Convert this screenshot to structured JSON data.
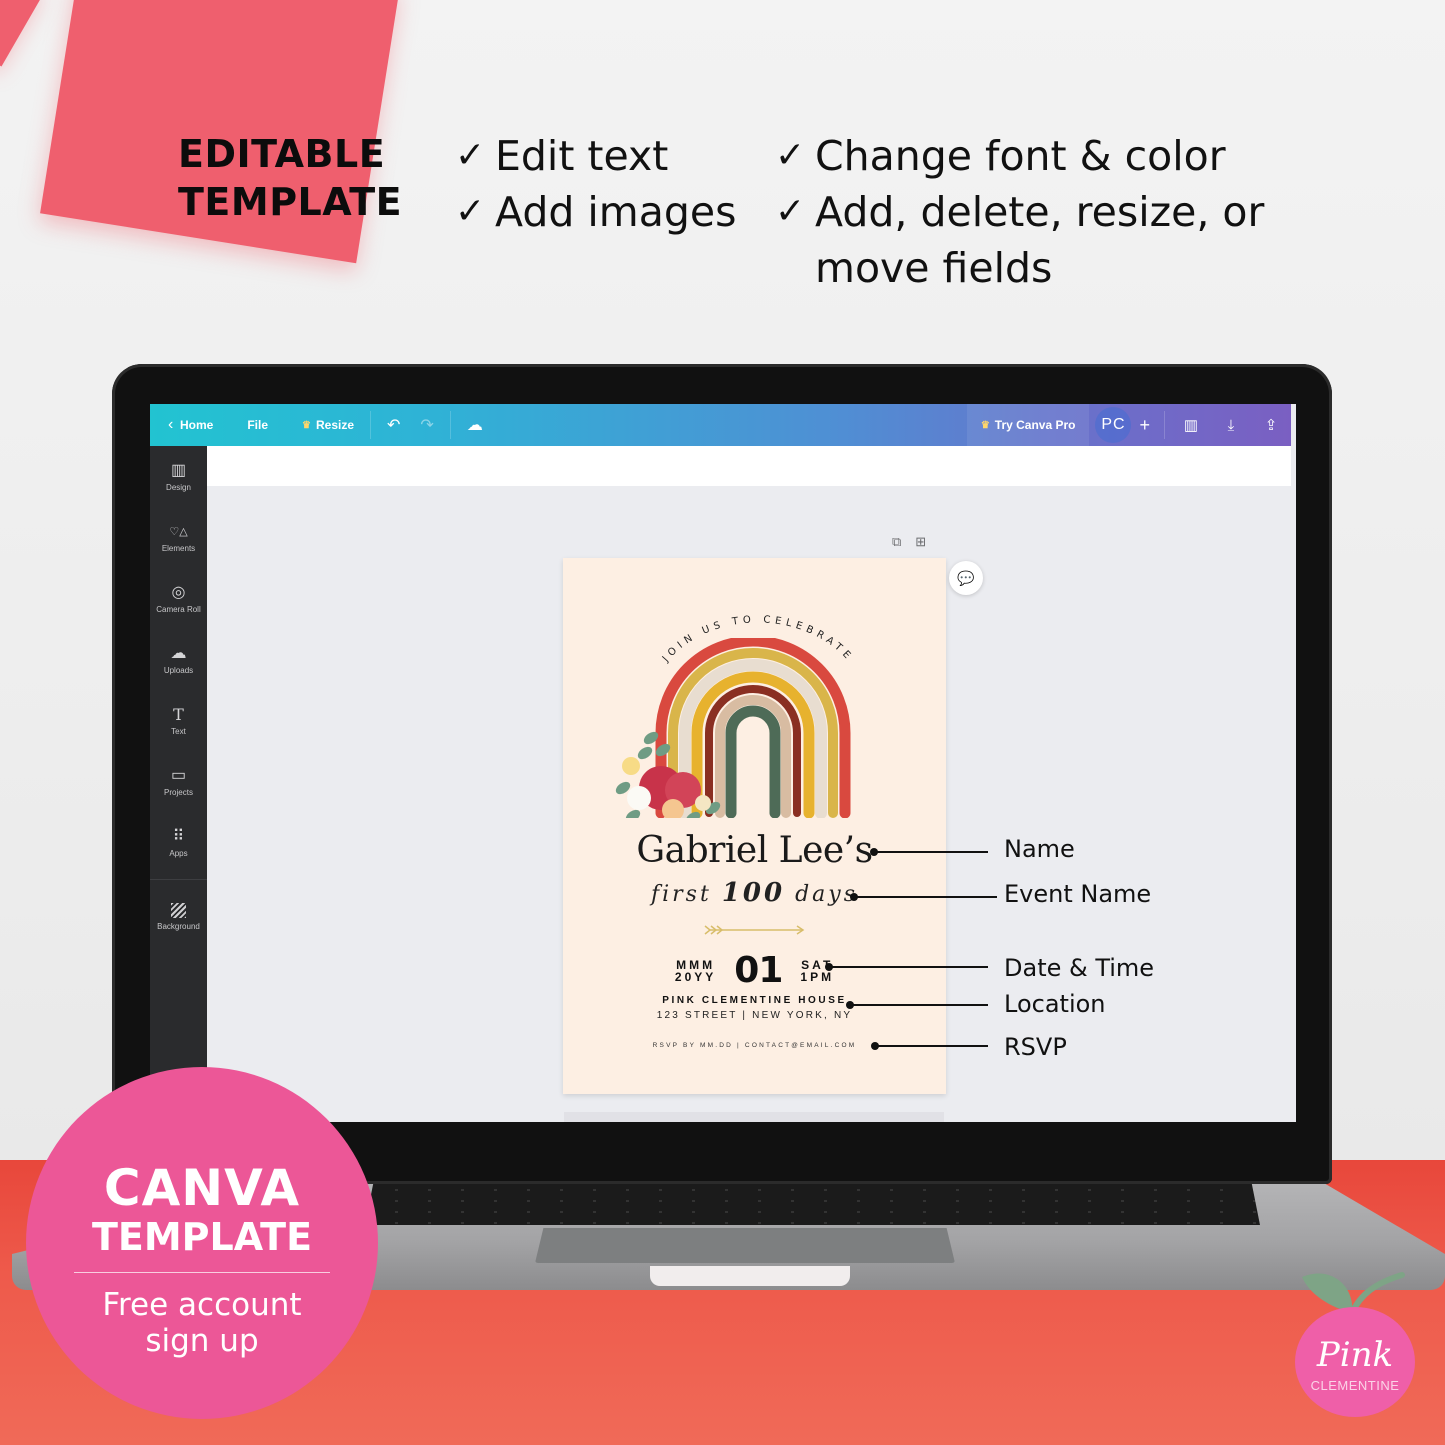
{
  "headline": {
    "line1": "EDITABLE",
    "line2": "TEMPLATE"
  },
  "features": {
    "check_glyph": "✓",
    "column1": [
      "Edit text",
      "Add images"
    ],
    "column2": [
      "Change font & color",
      "Add, delete, resize, or",
      "move fields"
    ]
  },
  "canva": {
    "topbar": {
      "back_icon": "‹",
      "home": "Home",
      "file": "File",
      "resize_crown": "♛",
      "resize": "Resize",
      "undo_icon": "↶",
      "redo_icon": "↷",
      "cloud_saved_icon": "☁",
      "try_pro_crown": "♛",
      "try_pro": "Try Canva Pro",
      "avatar_initials": "PC",
      "add_icon": "+",
      "analytics_icon": "▥",
      "download_icon": "⤓",
      "share_icon": "⇪"
    },
    "sidebar": [
      {
        "label": "Design",
        "icon": "▥"
      },
      {
        "label": "Elements",
        "icon": "♡△"
      },
      {
        "label": "Camera Roll",
        "icon": "◎"
      },
      {
        "label": "Uploads",
        "icon": "☁"
      },
      {
        "label": "Text",
        "icon": "T"
      },
      {
        "label": "Projects",
        "icon": "▭"
      },
      {
        "label": "Apps",
        "icon": "⠿"
      },
      {
        "label": "Background",
        "icon": ""
      }
    ],
    "page_tools": {
      "duplicate_icon": "⧉",
      "add_page_icon": "⊞",
      "comment_icon": "💬"
    }
  },
  "invitation": {
    "arc_text": "JOIN US TO CELEBRATE",
    "name": "Gabriel Lee’s",
    "event_prefix": "first",
    "event_number": "100",
    "event_suffix": "days",
    "month": "MMM",
    "year": "20YY",
    "day": "01",
    "weekday": "SAT",
    "time": "1PM",
    "venue": "PINK CLEMENTINE HOUSE",
    "address": "123 STREET | NEW YORK, NY",
    "rsvp": "RSVP BY MM.DD | CONTACT@EMAIL.COM",
    "colors": {
      "card_bg": "#fdefe3",
      "rainbow": [
        "#d9493f",
        "#d9b54a",
        "#e8ddd0",
        "#e7b22e",
        "#8a2f22",
        "#d8bca2",
        "#4e6b57"
      ]
    }
  },
  "callouts": [
    {
      "label": "Name"
    },
    {
      "label": "Event Name"
    },
    {
      "label": "Date & Time"
    },
    {
      "label": "Location"
    },
    {
      "label": "RSVP"
    }
  ],
  "badge": {
    "title1": "CANVA",
    "title2": "TEMPLATE",
    "subtitle_line1": "Free account",
    "subtitle_line2": "sign up",
    "color": "#ec5797"
  },
  "logo": {
    "script": "Pink",
    "word": "CLEMENTINE"
  }
}
